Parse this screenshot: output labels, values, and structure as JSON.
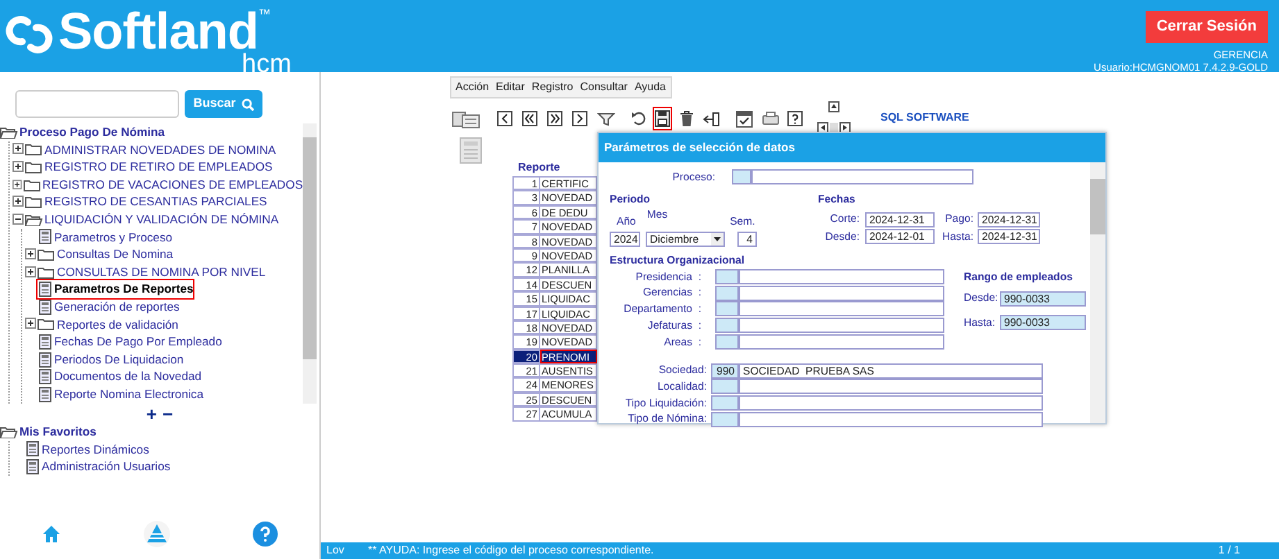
{
  "header": {
    "logo": "Softland",
    "trademark": "™",
    "logo_sub": "hcm",
    "logout_button": "Cerrar Sesión",
    "company": "GERENCIA",
    "user": "Usuario:HCMGNOM01 7.4.2.9-GOLD"
  },
  "sidebar": {
    "search": {
      "button": "Buscar"
    },
    "tree": [
      {
        "label": "Proceso Pago De Nómina",
        "kind": "folder",
        "expanded": true,
        "selected": false,
        "children": [
          {
            "label": "ADMINISTRAR NOVEDADES DE NOMINA",
            "kind": "folder",
            "expanded": false,
            "selected": false
          },
          {
            "label": "REGISTRO DE RETIRO DE EMPLEADOS",
            "kind": "folder",
            "expanded": false,
            "selected": false
          },
          {
            "label": "REGISTRO DE VACACIONES DE EMPLEADOS",
            "kind": "folder",
            "expanded": false,
            "selected": false
          },
          {
            "label": "REGISTRO DE CESANTIAS PARCIALES",
            "kind": "folder",
            "expanded": false,
            "selected": false
          },
          {
            "label": "LIQUIDACIÓN Y VALIDACIÓN DE NÓMINA",
            "kind": "folder",
            "expanded": true,
            "selected": false,
            "children": [
              {
                "label": "Parametros y Proceso",
                "kind": "doc",
                "selected": false
              },
              {
                "label": "Consultas De Nomina",
                "kind": "folder",
                "expanded": false,
                "selected": false
              },
              {
                "label": "CONSULTAS DE NOMINA POR NIVEL",
                "kind": "folder",
                "expanded": false,
                "selected": false
              },
              {
                "label": "Parametros De Reportes",
                "kind": "doc",
                "selected": true
              },
              {
                "label": "Generación de reportes",
                "kind": "doc",
                "selected": false
              },
              {
                "label": "Reportes de validación",
                "kind": "folder",
                "expanded": false,
                "selected": false
              },
              {
                "label": "Fechas De Pago Por Empleado",
                "kind": "doc",
                "selected": false
              },
              {
                "label": "Periodos De Liquidacion",
                "kind": "doc",
                "selected": false
              },
              {
                "label": "Documentos de la Novedad",
                "kind": "doc",
                "selected": false
              },
              {
                "label": "Reporte Nomina Electronica",
                "kind": "doc",
                "selected": false
              }
            ]
          }
        ]
      }
    ],
    "zoom_in": "+",
    "zoom_out": "−",
    "favorites": [
      {
        "label": "Mis Favoritos",
        "kind": "folder",
        "expanded": true,
        "selected": false,
        "children": [
          {
            "label": "Reportes Dinámicos",
            "kind": "doc",
            "selected": false
          },
          {
            "label": "Administración Usuarios",
            "kind": "doc",
            "selected": false
          }
        ]
      }
    ]
  },
  "menu": [
    "Acción",
    "Editar",
    "Registro",
    "Consultar",
    "Ayuda"
  ],
  "toolbar": {
    "items": [
      {
        "kind": "list",
        "selected": false
      },
      {
        "kind": "prev",
        "selected": false
      },
      {
        "kind": "first",
        "selected": false
      },
      {
        "kind": "last",
        "selected": false
      },
      {
        "kind": "next",
        "selected": false
      },
      {
        "kind": "filter",
        "selected": false
      },
      {
        "kind": "undo",
        "selected": false
      },
      {
        "kind": "save",
        "selected": true
      },
      {
        "kind": "delete",
        "selected": false
      },
      {
        "kind": "exit",
        "selected": false
      },
      {
        "kind": "check",
        "selected": false
      },
      {
        "kind": "print",
        "selected": false
      },
      {
        "kind": "help",
        "selected": false
      }
    ],
    "brand": "SQL SOFTWARE"
  },
  "reports": {
    "header": "Reporte",
    "rows": [
      {
        "number": "1",
        "name": "CERTIFIC",
        "selected": false
      },
      {
        "number": "3",
        "name": "NOVEDAD",
        "selected": false
      },
      {
        "number": "6",
        "name": "DE DEDU",
        "selected": false
      },
      {
        "number": "7",
        "name": "NOVEDAD",
        "selected": false
      },
      {
        "number": "8",
        "name": "NOVEDAD",
        "selected": false
      },
      {
        "number": "9",
        "name": "NOVEDAD",
        "selected": false
      },
      {
        "number": "12",
        "name": "PLANILLA",
        "selected": false
      },
      {
        "number": "14",
        "name": "DESCUEN",
        "selected": false
      },
      {
        "number": "15",
        "name": "LIQUIDAC",
        "selected": false
      },
      {
        "number": "17",
        "name": "LIQUIDAC",
        "selected": false
      },
      {
        "number": "18",
        "name": "NOVEDAD",
        "selected": false
      },
      {
        "number": "19",
        "name": "NOVEDAD",
        "selected": false
      },
      {
        "number": "20",
        "name": "PRENOMI",
        "selected": true
      },
      {
        "number": "21",
        "name": "AUSENTIS",
        "selected": false
      },
      {
        "number": "24",
        "name": "MENORES",
        "selected": false
      },
      {
        "number": "25",
        "name": "DESCUEN",
        "selected": false
      },
      {
        "number": "27",
        "name": "ACUMULA",
        "selected": false
      }
    ]
  },
  "dialog": {
    "title": "Parámetros de selección de datos",
    "proceso": {
      "label": "Proceso:"
    },
    "periodo": {
      "heading": "Periodo",
      "year_label": "Año",
      "year": "2024",
      "month_label": "Mes",
      "month": "Diciembre",
      "week_label": "Sem.",
      "week": "4"
    },
    "fechas": {
      "heading": "Fechas",
      "corte_label": "Corte:",
      "corte": "2024-12-31",
      "desde_label": "Desde:",
      "desde": "2024-12-01",
      "pago_label": "Pago:",
      "pago": "2024-12-31",
      "hasta_label": "Hasta:",
      "hasta": "2024-12-31"
    },
    "estructura": {
      "heading": "Estructura Organizacional",
      "rows": [
        "Presidencia  :",
        "Gerencias  :",
        "Departamento  :",
        "Jefaturas  :",
        "Areas  :"
      ]
    },
    "rango": {
      "heading": "Rango de empleados",
      "desde_label": "Desde:",
      "desde": "990-0033",
      "hasta_label": "Hasta:",
      "hasta": "990-0033"
    },
    "lower": [
      {
        "label": "Sociedad:",
        "code": "990",
        "name": "SOCIEDAD  PRUEBA SAS"
      },
      {
        "label": "Localidad:"
      },
      {
        "label": "Tipo Liquidación:"
      },
      {
        "label": "Tipo de Nómina:"
      }
    ]
  },
  "status_bar": {
    "mode": "Lov",
    "message": "** AYUDA: Ingrese el código del proceso correspondiente.",
    "page": "1 / 1"
  }
}
